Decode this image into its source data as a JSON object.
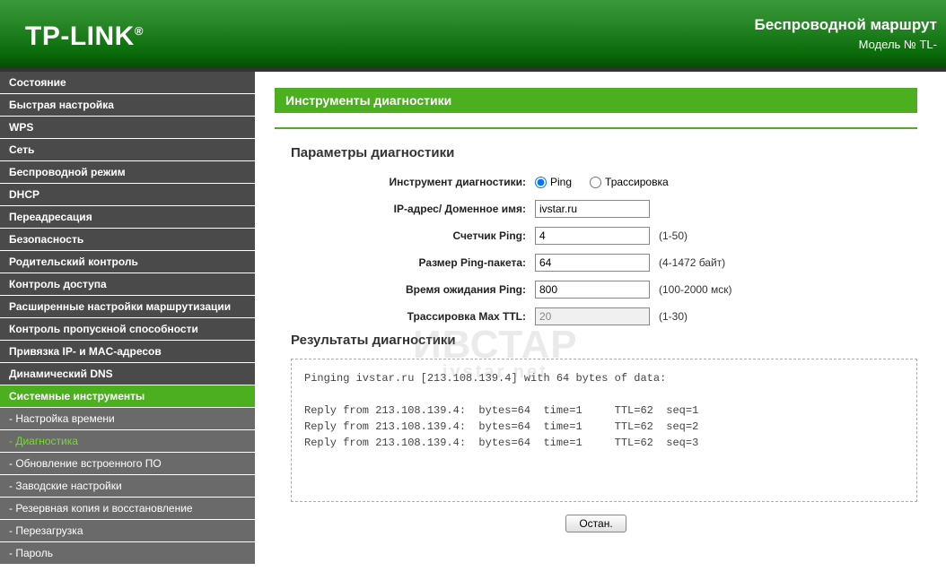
{
  "banner": {
    "logo": "TP-LINK",
    "product_line1": "Беспроводной маршрут",
    "product_line2": "Модель № TL-"
  },
  "sidebar": {
    "items": [
      {
        "label": "Состояние",
        "type": "top"
      },
      {
        "label": "Быстрая настройка",
        "type": "top"
      },
      {
        "label": "WPS",
        "type": "top"
      },
      {
        "label": "Сеть",
        "type": "top"
      },
      {
        "label": "Беспроводной режим",
        "type": "top"
      },
      {
        "label": "DHCP",
        "type": "top"
      },
      {
        "label": "Переадресация",
        "type": "top"
      },
      {
        "label": "Безопасность",
        "type": "top"
      },
      {
        "label": "Родительский контроль",
        "type": "top"
      },
      {
        "label": "Контроль доступа",
        "type": "top"
      },
      {
        "label": "Расширенные настройки маршрутизации",
        "type": "top"
      },
      {
        "label": "Контроль пропускной способности",
        "type": "top"
      },
      {
        "label": "Привязка IP- и MAC-адресов",
        "type": "top"
      },
      {
        "label": "Динамический DNS",
        "type": "top"
      },
      {
        "label": "Системные инструменты",
        "type": "active-parent"
      },
      {
        "label": "- Настройка времени",
        "type": "sub"
      },
      {
        "label": "- Диагностика",
        "type": "active-sub"
      },
      {
        "label": "- Обновление встроенного ПО",
        "type": "sub"
      },
      {
        "label": "- Заводские настройки",
        "type": "sub"
      },
      {
        "label": "- Резервная копия и восстановление",
        "type": "sub"
      },
      {
        "label": "- Перезагрузка",
        "type": "sub"
      },
      {
        "label": "- Пароль",
        "type": "sub"
      }
    ]
  },
  "page": {
    "title": "Инструменты диагностики",
    "section_params": "Параметры диагностики",
    "section_results": "Результаты диагностики",
    "labels": {
      "tool": "Инструмент диагностики:",
      "ip": "IP-адрес/ Доменное имя:",
      "count": "Счетчик Ping:",
      "size": "Размер Ping-пакета:",
      "timeout": "Время ожидания Ping:",
      "ttl": "Трассировка Max TTL:"
    },
    "radio": {
      "ping": "Ping",
      "trace": "Трассировка"
    },
    "fields": {
      "ip": "ivstar.ru",
      "count": "4",
      "size": "64",
      "timeout": "800",
      "ttl": "20"
    },
    "hints": {
      "count": "(1-50)",
      "size": "(4-1472 байт)",
      "timeout": "(100-2000 мск)",
      "ttl": "(1-30)"
    },
    "results": "Pinging ivstar.ru [213.108.139.4] with 64 bytes of data:\n\nReply from 213.108.139.4:  bytes=64  time=1     TTL=62  seq=1\nReply from 213.108.139.4:  bytes=64  time=1     TTL=62  seq=2\nReply from 213.108.139.4:  bytes=64  time=1     TTL=62  seq=3",
    "button": "Остан."
  },
  "watermark": {
    "main": "ИВСТАР",
    "sub": "ivstar.net"
  }
}
